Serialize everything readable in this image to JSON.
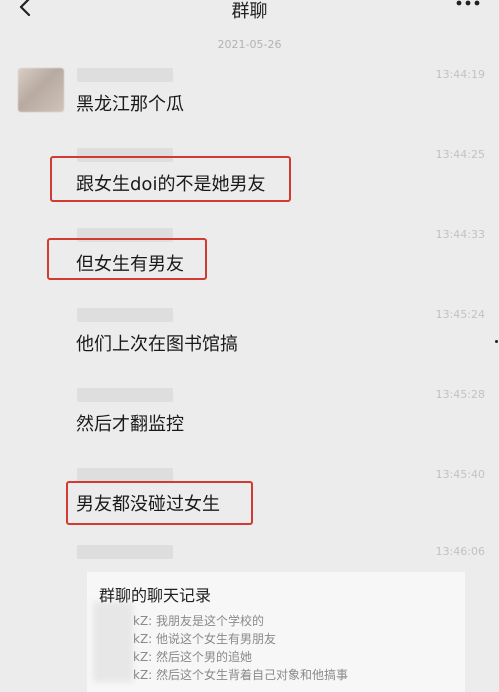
{
  "header": {
    "title": "群聊"
  },
  "date": "2021-05-26",
  "messages": [
    {
      "time": "13:44:19",
      "text": "黑龙江那个瓜"
    },
    {
      "time": "13:44:25",
      "text": "跟女生doi的不是她男友"
    },
    {
      "time": "13:44:33",
      "text": "但女生有男友"
    },
    {
      "time": "13:45:24",
      "text": "他们上次在图书馆搞"
    },
    {
      "time": "13:45:28",
      "text": "然后才翻监控"
    },
    {
      "time": "13:45:40",
      "text": "男友都没碰过女生"
    },
    {
      "time": "13:46:06"
    }
  ],
  "record": {
    "title": "群聊的聊天记录",
    "lines": [
      "kZ: 我朋友是这个学校的",
      "kZ: 他说这个女生有男朋友",
      "kZ: 然后这个男的追她",
      "kZ: 然后这个女生背着自己对象和他搞事"
    ]
  },
  "icons": {
    "back": "chevron-left-icon",
    "more": "more-dots-icon"
  },
  "colors": {
    "highlight_box": "#d23b31",
    "background": "#ececec"
  }
}
